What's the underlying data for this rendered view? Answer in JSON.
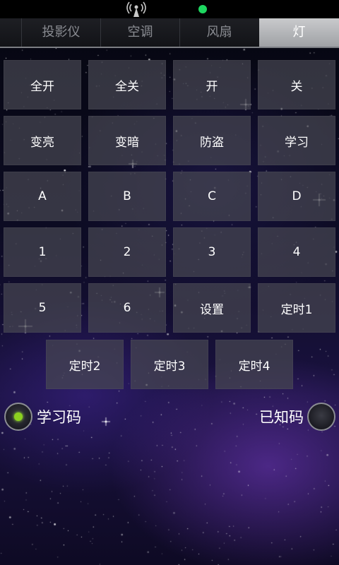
{
  "status_bar": {
    "indicator_color": "#1ed760"
  },
  "tabs": [
    {
      "label": "",
      "active": false
    },
    {
      "label": "投影仪",
      "active": false
    },
    {
      "label": "空调",
      "active": false
    },
    {
      "label": "风扇",
      "active": false
    },
    {
      "label": "灯",
      "active": true
    }
  ],
  "buttons": {
    "rows": [
      [
        "全开",
        "全关",
        "开",
        "关"
      ],
      [
        "变亮",
        "变暗",
        "防盗",
        "学习"
      ],
      [
        "A",
        "B",
        "C",
        "D"
      ],
      [
        "1",
        "2",
        "3",
        "4"
      ],
      [
        "5",
        "6",
        "设置",
        "定时1"
      ],
      [
        "定时2",
        "定时3",
        "定时4"
      ]
    ]
  },
  "modes": {
    "learn": {
      "label": "学习码",
      "selected": true
    },
    "known": {
      "label": "已知码",
      "selected": false
    }
  },
  "colors": {
    "selected_radio": "#8cd020",
    "active_tab": "#b5b6b9"
  }
}
